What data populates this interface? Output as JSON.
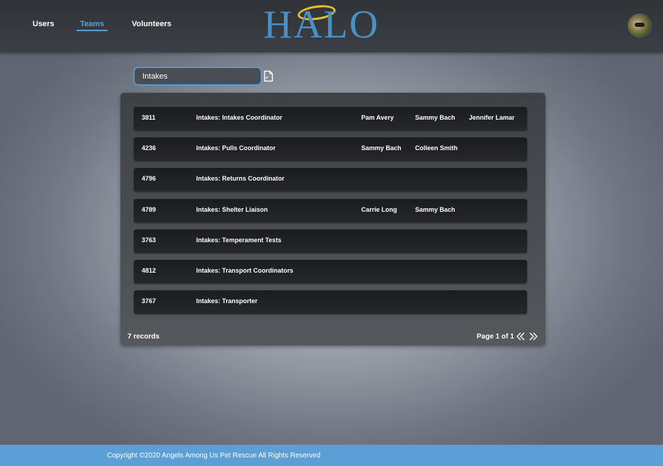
{
  "nav": {
    "items": [
      {
        "label": "Users"
      },
      {
        "label": "Teams",
        "active": true
      },
      {
        "label": "Volunteers"
      }
    ]
  },
  "logo": {
    "text": "HALO"
  },
  "search": {
    "value": "Intakes"
  },
  "teams": [
    {
      "id": "3811",
      "name": "Intakes: Intakes Coordinator",
      "members": [
        "Pam Avery",
        "Sammy Bach",
        "Jennifer Lamar"
      ]
    },
    {
      "id": "4236",
      "name": "Intakes: Pulls Coordinator",
      "members": [
        "Sammy Bach",
        "Colleen Smith",
        ""
      ]
    },
    {
      "id": "4796",
      "name": "Intakes: Returns Coordinator",
      "members": [
        "",
        "",
        ""
      ]
    },
    {
      "id": "4789",
      "name": "Intakes: Shelter Liaison",
      "members": [
        "Carrie Long",
        "Sammy Bach",
        ""
      ]
    },
    {
      "id": "3763",
      "name": "Intakes: Temperament Tests",
      "members": [
        "",
        "",
        ""
      ]
    },
    {
      "id": "4812",
      "name": "Intakes: Transport Coordinators",
      "members": [
        "",
        "",
        ""
      ]
    },
    {
      "id": "3767",
      "name": "Intakes: Transporter",
      "members": [
        "",
        "",
        ""
      ]
    }
  ],
  "table_footer": {
    "records": "7 records",
    "page": "Page 1 of 1"
  },
  "footer": {
    "copyright": "Copyright ©2020 Angels Among Us Pet Rescue All Rights Reserved"
  },
  "colors": {
    "accent": "#5b9fd6",
    "logo": "#4a90c8",
    "halo": "#e8c224",
    "row": "#1f2022"
  },
  "icons": {
    "new": "new-file-icon",
    "prev": "chevron-double-left-icon",
    "next": "chevron-double-right-icon",
    "avatar": "user-avatar"
  }
}
